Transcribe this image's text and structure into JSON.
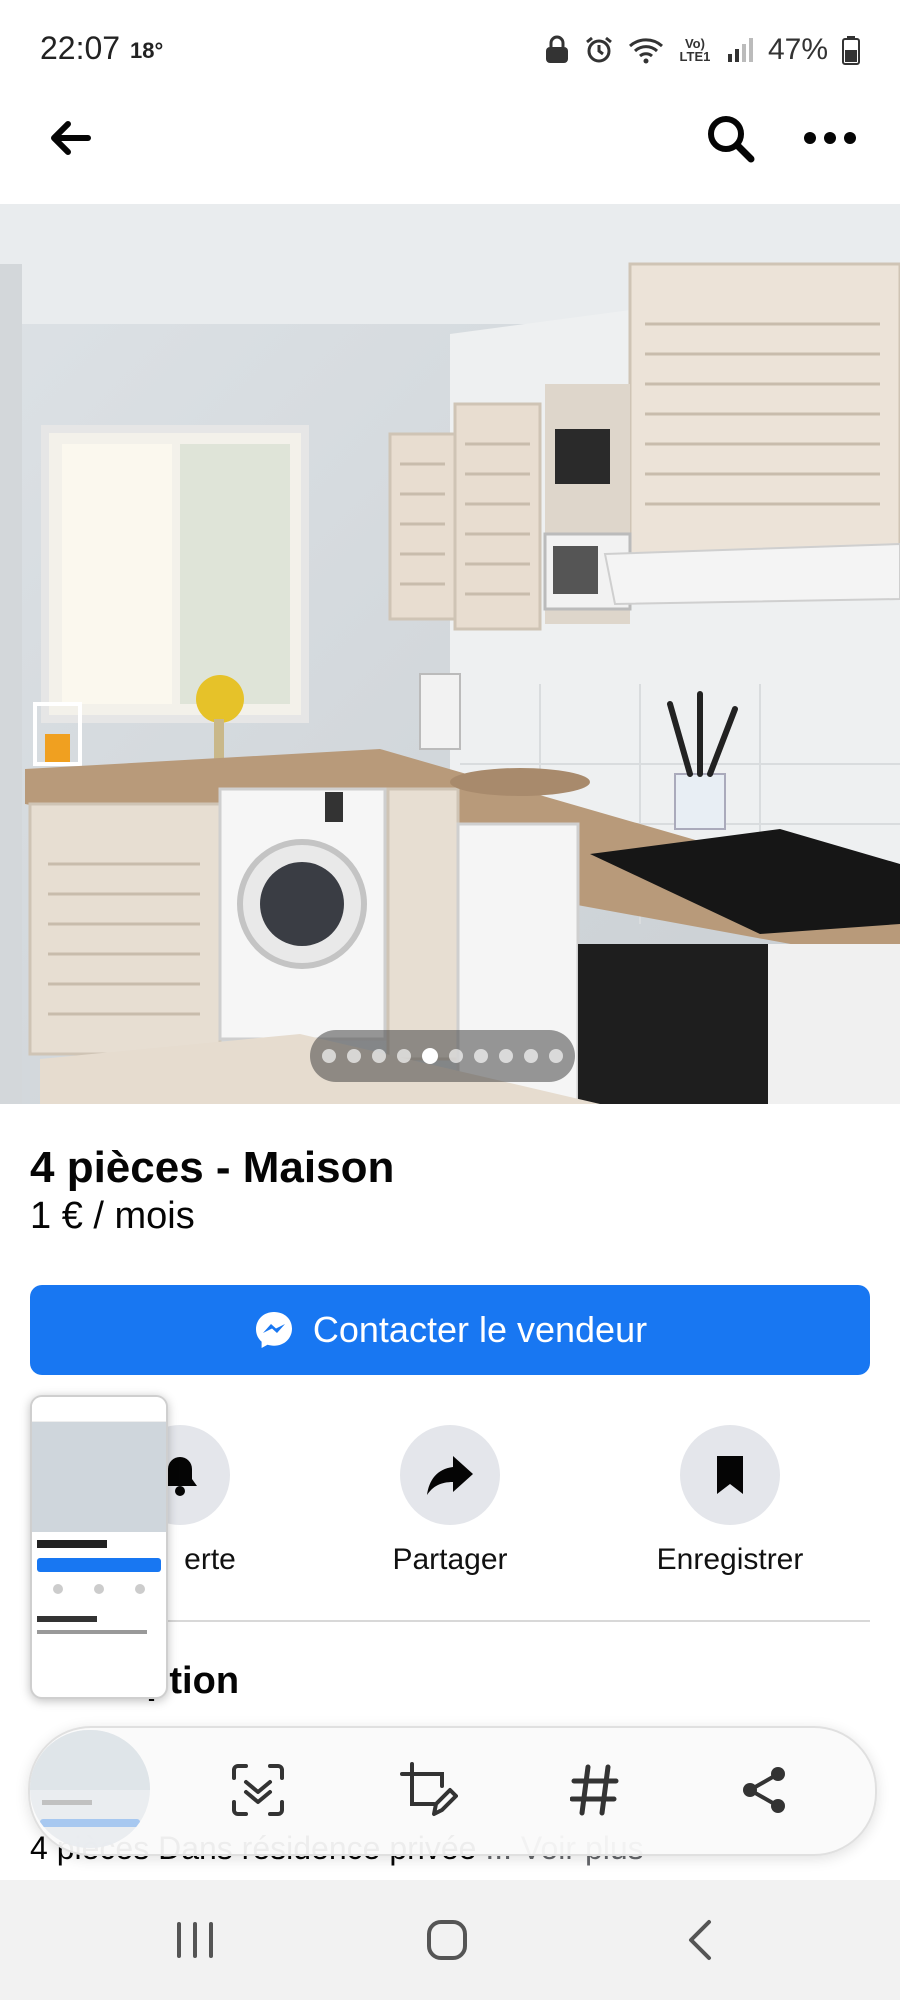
{
  "status_bar": {
    "time": "22:07",
    "temperature": "18°",
    "network_label": "Vo) LTE1",
    "battery": "47%"
  },
  "app_bar": {
    "back_icon": "arrow-left-icon",
    "search_icon": "search-icon",
    "more_icon": "more-horizontal-icon"
  },
  "photo": {
    "description_icon": "kitchen-photo",
    "carousel": {
      "count": 10,
      "active_index": 4
    }
  },
  "listing": {
    "title": "4 pièces - Maison",
    "price": "1 € / mois"
  },
  "contact_button": {
    "label": "Contacter le vendeur",
    "icon": "messenger-icon",
    "color": "#1877f2"
  },
  "actions": [
    {
      "label": "erte",
      "icon": "bell-icon"
    },
    {
      "label": "Partager",
      "icon": "share-arrow-icon"
    },
    {
      "label": "Enregistrer",
      "icon": "bookmark-icon"
    }
  ],
  "description": {
    "heading": "Description",
    "text": "4 pièces Dans résidence privée",
    "see_more": "... Voir plus"
  },
  "screenshot_toolbar": {
    "buttons": [
      "scan-text-icon",
      "edit-crop-icon",
      "hashtag-icon",
      "share-icon"
    ]
  },
  "nav_bar": {
    "buttons": [
      "recents-icon",
      "home-icon",
      "back-icon"
    ]
  }
}
